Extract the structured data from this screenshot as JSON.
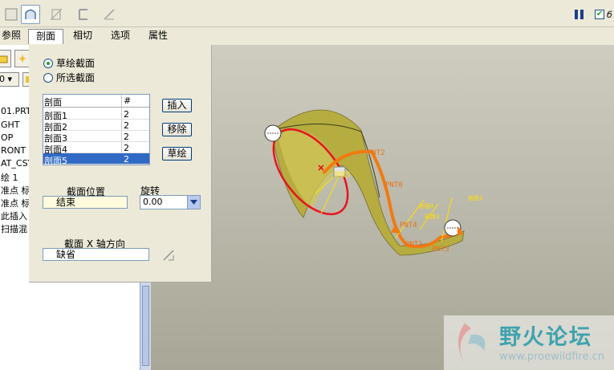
{
  "toolbar": {
    "icons": [
      "solid-sweep-icon",
      "surface-sweep-icon",
      "remove-material-icon",
      "thicken-icon",
      "edit-icon"
    ],
    "pause_icon": "pause-icon",
    "preview_checked": true,
    "preview_partial_text": "б"
  },
  "tabs": [
    {
      "label": "参照"
    },
    {
      "label": "剖面",
      "active": true
    },
    {
      "label": "相切"
    },
    {
      "label": "选项"
    },
    {
      "label": "属性"
    }
  ],
  "model_tree": {
    "items": [
      "01.PRT",
      "GHT",
      "OP",
      "RONT",
      "AT_CSYS",
      "绘 1",
      "准点 标",
      "准点 标",
      "此插入",
      "扫描混"
    ],
    "dropdown_partial": "0"
  },
  "section_panel": {
    "radio_sketch": "草绘截面",
    "radio_selected": "所选截面",
    "table": {
      "header_name": "剖面",
      "header_count": "#",
      "rows": [
        {
          "name": "剖面1",
          "count": "2"
        },
        {
          "name": "剖面2",
          "count": "2"
        },
        {
          "name": "剖面3",
          "count": "2"
        },
        {
          "name": "剖面4",
          "count": "2"
        },
        {
          "name": "剖面5",
          "count": "2",
          "selected": true
        }
      ]
    },
    "buttons": {
      "insert": "插入",
      "remove": "移除",
      "sketch": "草绘"
    },
    "position_label": "截面位置",
    "position_value": "结束",
    "rotation_label": "旋转",
    "rotation_value": "0.00",
    "x_axis_label": "截面 X 轴方向",
    "x_axis_value": "缺省"
  },
  "viewport": {
    "labels": {
      "pnt0": "PNT0",
      "pnt1": "PNT1",
      "pnt2": "PNT2",
      "pnt3": "PNT3",
      "pnt4": "PNT4",
      "section5": "剖面5",
      "section1": "剖面1",
      "section3": "剖面3",
      "section4": "剖面4"
    },
    "colors": {
      "surface": "#b8ad3a",
      "trajectory": "#f07a10",
      "section_edge": "#e8141e",
      "annotation": "#ffe000"
    }
  },
  "watermark": {
    "title": "野火论坛",
    "url": "www.proewildfire.cn"
  }
}
